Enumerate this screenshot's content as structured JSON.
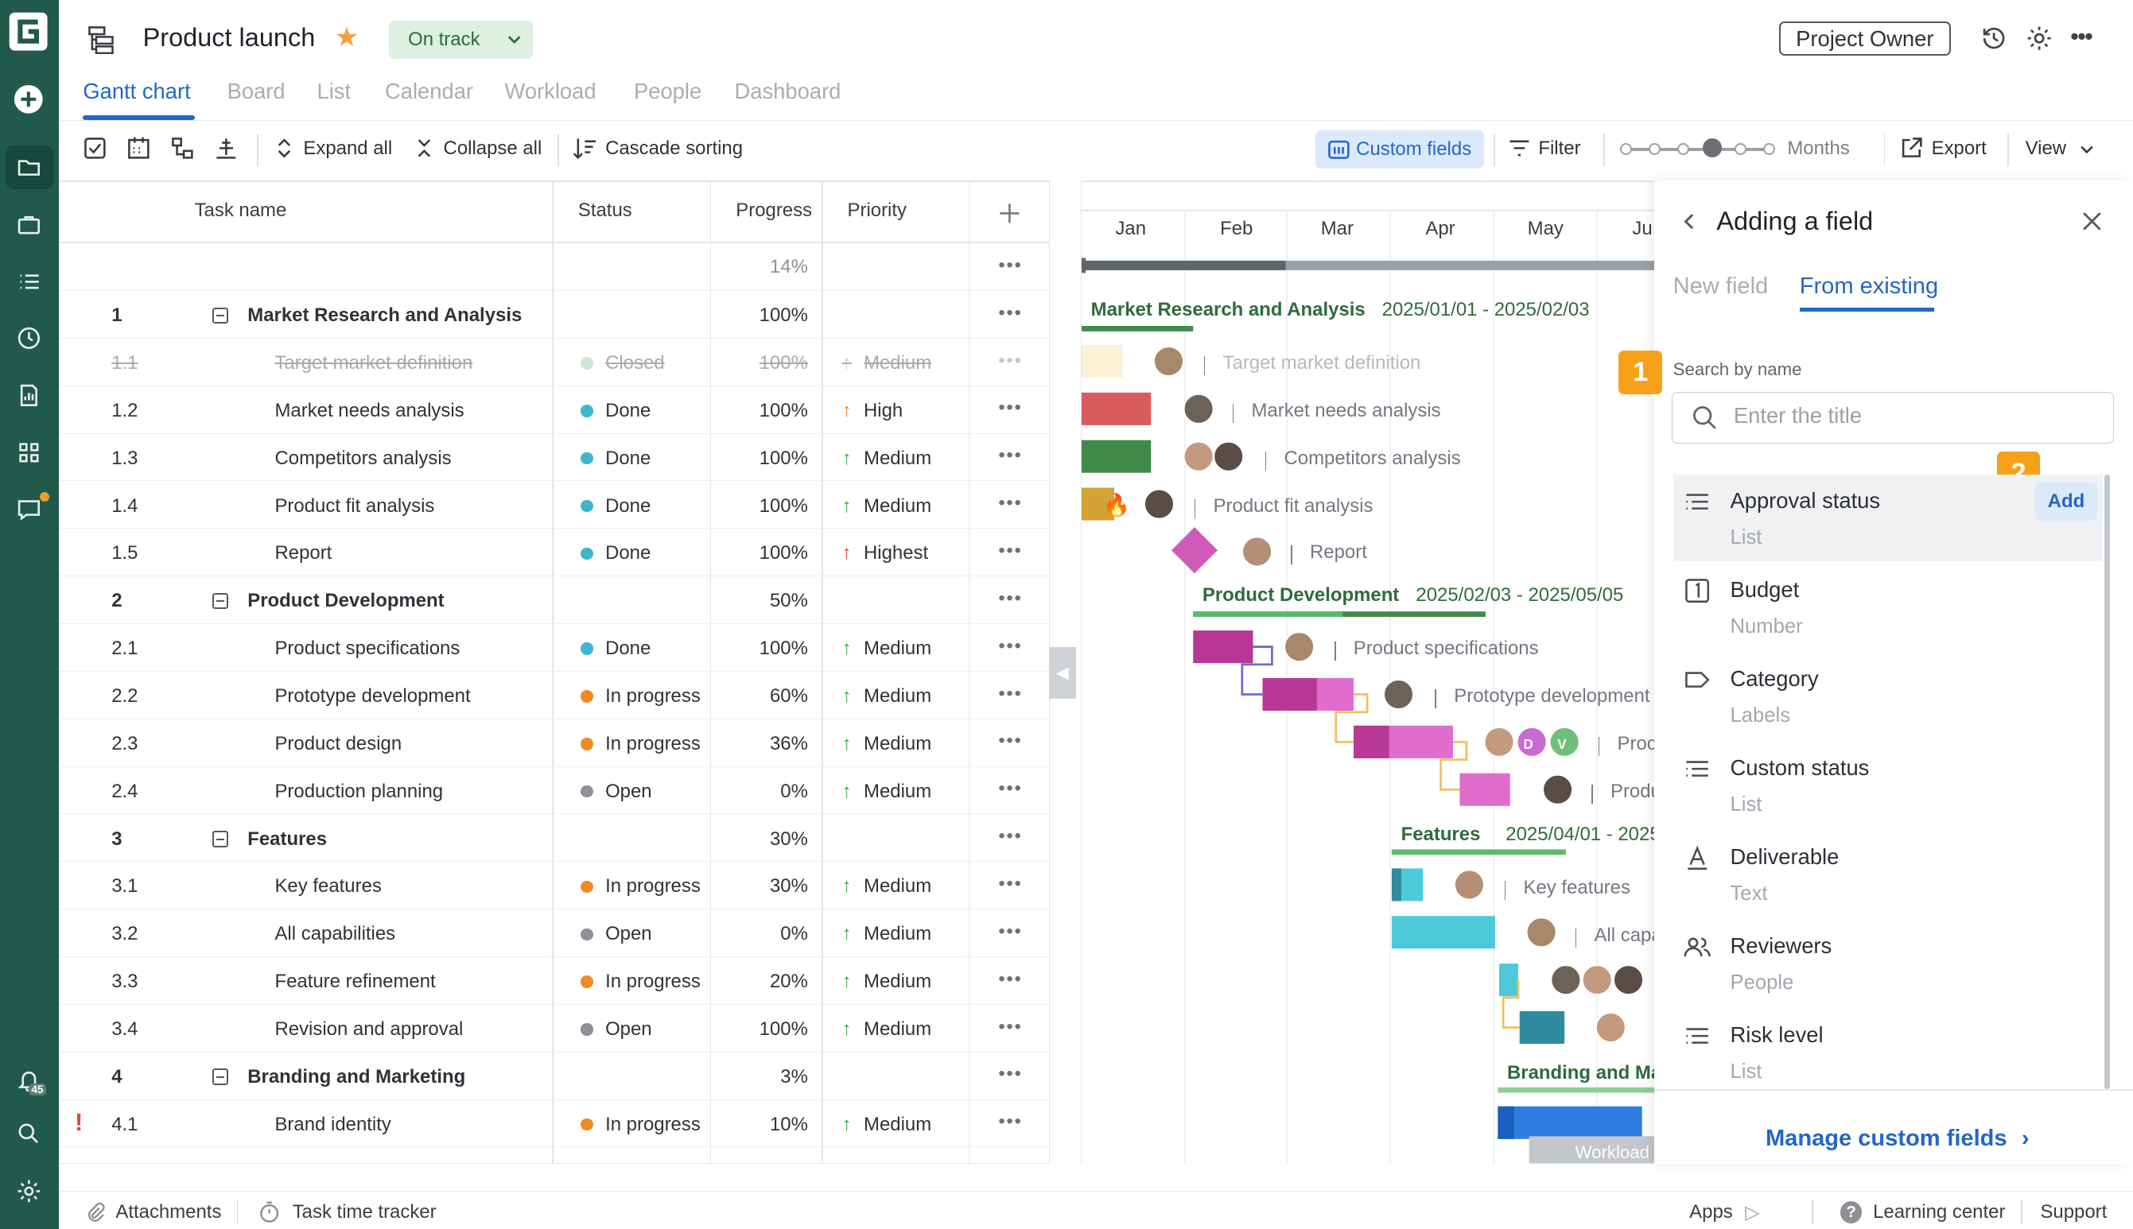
{
  "app": {
    "title": "Product launch",
    "status": "On track",
    "owner_button": "Project Owner"
  },
  "tabs": [
    "Gantt chart",
    "Board",
    "List",
    "Calendar",
    "Workload",
    "People",
    "Dashboard"
  ],
  "toolbar": {
    "expand": "Expand all",
    "collapse": "Collapse all",
    "cascade": "Cascade sorting",
    "custom_fields": "Custom fields",
    "filter": "Filter",
    "zoom": "Months",
    "export": "Export",
    "view": "View"
  },
  "columns": {
    "task": "Task name",
    "status": "Status",
    "progress": "Progress",
    "priority": "Priority"
  },
  "summary_progress": "14%",
  "rows": [
    {
      "num": "1",
      "name": "Market Research and Analysis",
      "progress": "100%",
      "group": true
    },
    {
      "num": "1.1",
      "name": "Target market definition",
      "status": "Closed",
      "progress": "100%",
      "priority": "Medium",
      "closed": true
    },
    {
      "num": "1.2",
      "name": "Market needs analysis",
      "status": "Done",
      "progress": "100%",
      "priority": "High"
    },
    {
      "num": "1.3",
      "name": "Competitors analysis",
      "status": "Done",
      "progress": "100%",
      "priority": "Medium"
    },
    {
      "num": "1.4",
      "name": "Product fit analysis",
      "status": "Done",
      "progress": "100%",
      "priority": "Medium"
    },
    {
      "num": "1.5",
      "name": "Report",
      "status": "Done",
      "progress": "100%",
      "priority": "Highest"
    },
    {
      "num": "2",
      "name": "Product Development",
      "progress": "50%",
      "group": true
    },
    {
      "num": "2.1",
      "name": "Product specifications",
      "status": "Done",
      "progress": "100%",
      "priority": "Medium"
    },
    {
      "num": "2.2",
      "name": "Prototype development",
      "status": "In progress",
      "progress": "60%",
      "priority": "Medium"
    },
    {
      "num": "2.3",
      "name": "Product design",
      "status": "In progress",
      "progress": "36%",
      "priority": "Medium"
    },
    {
      "num": "2.4",
      "name": "Production planning",
      "status": "Open",
      "progress": "0%",
      "priority": "Medium"
    },
    {
      "num": "3",
      "name": "Features",
      "progress": "30%",
      "group": true
    },
    {
      "num": "3.1",
      "name": "Key features",
      "status": "In progress",
      "progress": "30%",
      "priority": "Medium"
    },
    {
      "num": "3.2",
      "name": "All capabilities",
      "status": "Open",
      "progress": "0%",
      "priority": "Medium"
    },
    {
      "num": "3.3",
      "name": "Feature refinement",
      "status": "In progress",
      "progress": "20%",
      "priority": "Medium"
    },
    {
      "num": "3.4",
      "name": "Revision and approval",
      "status": "Open",
      "progress": "100%",
      "priority": "Medium"
    },
    {
      "num": "4",
      "name": "Branding and Marketing",
      "progress": "3%",
      "group": true
    },
    {
      "num": "4.1",
      "name": "Brand identity",
      "status": "In progress",
      "progress": "10%",
      "priority": "Medium",
      "flag": "!"
    }
  ],
  "gantt": {
    "months": [
      "Jan",
      "Feb",
      "Mar",
      "Apr",
      "May",
      "Ju"
    ],
    "groups": [
      {
        "name": "Market Research and Analysis",
        "dates": "2025/01/01 - 2025/02/03"
      },
      {
        "name": "Product Development",
        "dates": "2025/02/03 - 2025/05/05"
      },
      {
        "name": "Features",
        "dates": "2025/04/01 - 2025"
      },
      {
        "name": "Branding and Ma",
        "dates": ""
      }
    ],
    "labels": [
      "Target market definition",
      "Market needs analysis",
      "Competitors analysis",
      "Product fit analysis",
      "Report",
      "Product specifications",
      "Prototype development",
      "Proc",
      "Produ",
      "Key features",
      "All capa"
    ],
    "avatar_letters": [
      "D",
      "V"
    ],
    "workload_tab": "Workload"
  },
  "panel": {
    "title": "Adding a field",
    "tab_new": "New field",
    "tab_existing": "From existing",
    "search_label": "Search by name",
    "search_placeholder": "Enter the title",
    "add": "Add",
    "step1": "1",
    "step2": "2",
    "fields": [
      {
        "name": "Approval status",
        "type": "List"
      },
      {
        "name": "Budget",
        "type": "Number"
      },
      {
        "name": "Category",
        "type": "Labels"
      },
      {
        "name": "Custom status",
        "type": "List"
      },
      {
        "name": "Deliverable",
        "type": "Text"
      },
      {
        "name": "Reviewers",
        "type": "People"
      },
      {
        "name": "Risk level",
        "type": "List"
      }
    ],
    "manage": "Manage custom fields"
  },
  "footer": {
    "attachments": "Attachments",
    "time_tracker": "Task time tracker",
    "apps": "Apps",
    "learning": "Learning center",
    "support": "Support"
  },
  "sidebar": {
    "notif_count": "45"
  },
  "colors": {
    "sidebar": "#21594a",
    "accent": "#2366c9",
    "done": "#3fb6cf",
    "in_progress": "#f08a25",
    "open": "#8d9196",
    "badge": "#f7a118"
  }
}
